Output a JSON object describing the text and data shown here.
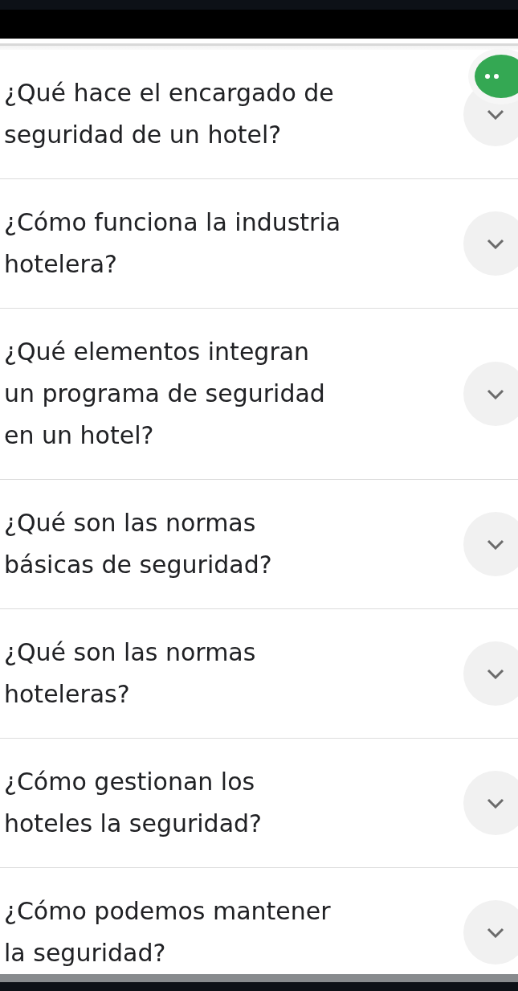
{
  "questions": [
    {
      "lines": [
        "¿Qué hace el encargado de",
        "seguridad de un hotel?"
      ],
      "expanded": false
    },
    {
      "lines": [
        "¿Cómo funciona la industria",
        "hotelera?"
      ],
      "expanded": false
    },
    {
      "lines": [
        "¿Qué elementos integran",
        "un programa de seguridad",
        "en un hotel?"
      ],
      "expanded": false
    },
    {
      "lines": [
        "¿Qué son las normas",
        "básicas de seguridad?"
      ],
      "expanded": false
    },
    {
      "lines": [
        "¿Qué son las normas",
        "hoteleras?"
      ],
      "expanded": false
    },
    {
      "lines": [
        "¿Cómo gestionan los",
        "hoteles la seguridad?"
      ],
      "expanded": false
    },
    {
      "lines": [
        "¿Cómo podemos mantener",
        "la seguridad?"
      ],
      "expanded": false
    }
  ]
}
